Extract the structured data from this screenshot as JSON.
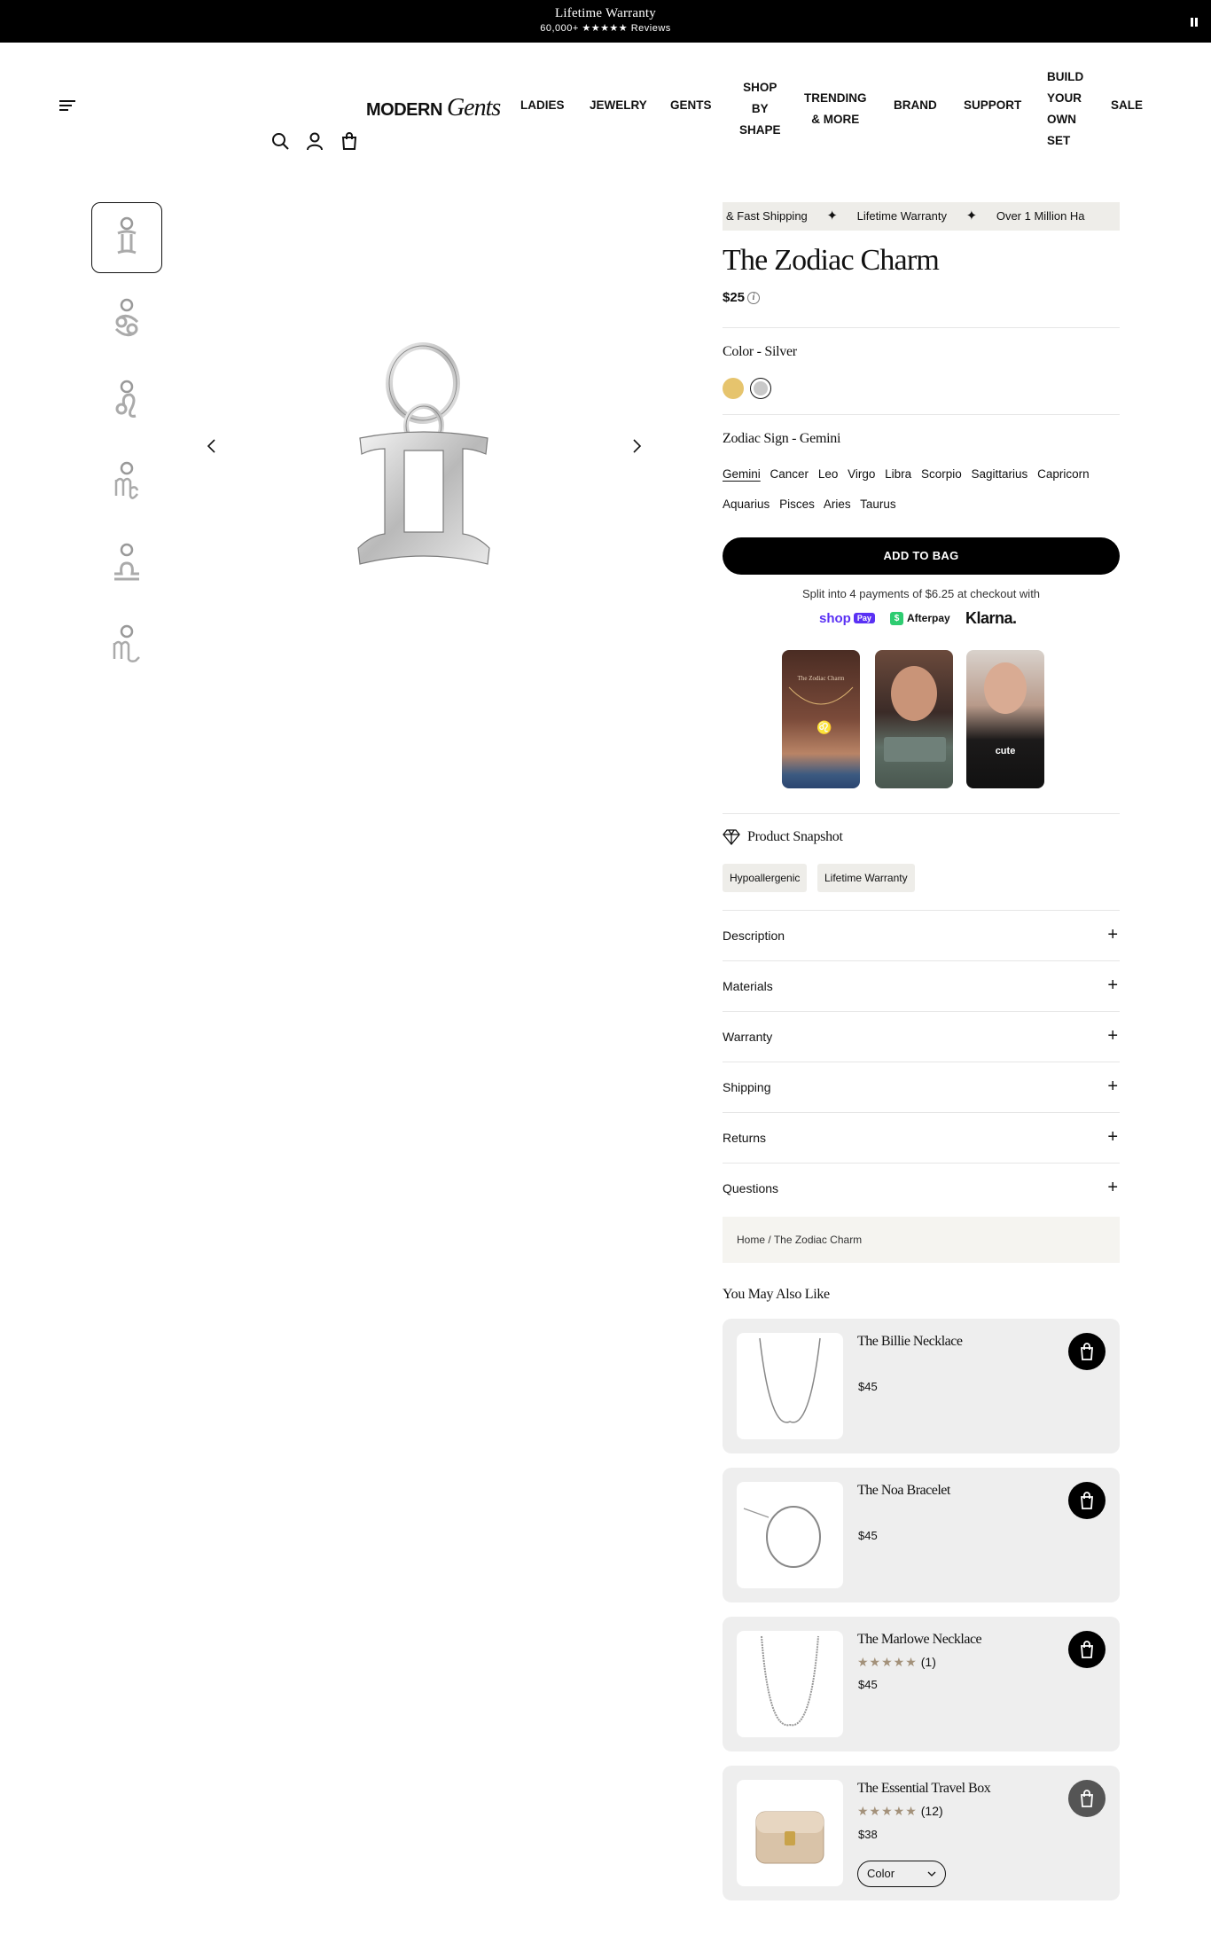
{
  "announcement": {
    "title": "Lifetime Warranty",
    "subtitle": "60,000+ ★★★★★ Reviews"
  },
  "header": {
    "logo_main": "MODERN",
    "logo_script": "Gents",
    "nav": [
      {
        "label": "LADIES"
      },
      {
        "label": "JEWELRY"
      },
      {
        "label": "GENTS"
      },
      {
        "label_lines": [
          "SHOP",
          "BY",
          "SHAPE"
        ]
      },
      {
        "label_lines": [
          "TRENDING",
          "& MORE"
        ]
      },
      {
        "label": "BRAND"
      },
      {
        "label": "SUPPORT"
      },
      {
        "label_lines": [
          "BUILD",
          "YOUR",
          "OWN",
          "SET"
        ]
      },
      {
        "label": "SALE"
      }
    ],
    "icons": [
      "search-icon",
      "account-icon",
      "bag-icon"
    ]
  },
  "gallery": {
    "thumbnail_glyphs": [
      "♊",
      "♋",
      "♌",
      "♍",
      "♎",
      "♏"
    ],
    "main_glyph": "♊"
  },
  "product": {
    "ticker": [
      "& Fast Shipping",
      "Lifetime Warranty",
      "Over 1 Million Ha"
    ],
    "title": "The Zodiac Charm",
    "price": "$25",
    "color_label": "Color - Silver",
    "colors": [
      {
        "name": "Gold",
        "hex": "#e6c46d"
      },
      {
        "name": "Silver",
        "hex": "#c9c9c9"
      }
    ],
    "sign_label": "Zodiac Sign - Gemini",
    "signs_row1": [
      "Gemini",
      "Cancer",
      "Leo",
      "Virgo",
      "Libra",
      "Scorpio",
      "Sagittarius",
      "Capricorn"
    ],
    "signs_row2": [
      "Aquarius",
      "Pisces",
      "Aries",
      "Taurus"
    ],
    "add_to_bag": "ADD TO BAG",
    "split_text": "Split into 4 payments of $6.25 at checkout with",
    "pay_methods": {
      "shop": "shop",
      "shop_pay": "Pay",
      "afterpay": "Afterpay",
      "klarna": "Klarna."
    },
    "video_captions": [
      "The Zodiac Charm",
      "",
      "cute"
    ],
    "snapshot_title": "Product Snapshot",
    "snapshot_chips": [
      "Hypoallergenic",
      "Lifetime Warranty"
    ],
    "accordions": [
      "Description",
      "Materials",
      "Warranty",
      "Shipping",
      "Returns",
      "Questions"
    ],
    "breadcrumb": {
      "home": "Home",
      "sep": " / ",
      "current": "The Zodiac Charm"
    }
  },
  "recommendations": {
    "title": "You May Also Like",
    "items": [
      {
        "name": "The Billie Necklace",
        "price": "$45",
        "stars": "",
        "count": ""
      },
      {
        "name": "The Noa Bracelet",
        "price": "$45",
        "stars": "",
        "count": ""
      },
      {
        "name": "The Marlowe Necklace",
        "price": "$45",
        "stars": "★★★★★",
        "count": "(1)"
      },
      {
        "name": "The Essential Travel Box",
        "price": "$38",
        "stars": "★★★★★",
        "count": "(12)",
        "select": "Color"
      }
    ]
  },
  "colors": {
    "accent_black": "#000000",
    "panel_grey": "#eeede9",
    "star_color": "#a3917a",
    "shop_pay": "#5a31f4",
    "afterpay_green": "#2ecc71"
  }
}
